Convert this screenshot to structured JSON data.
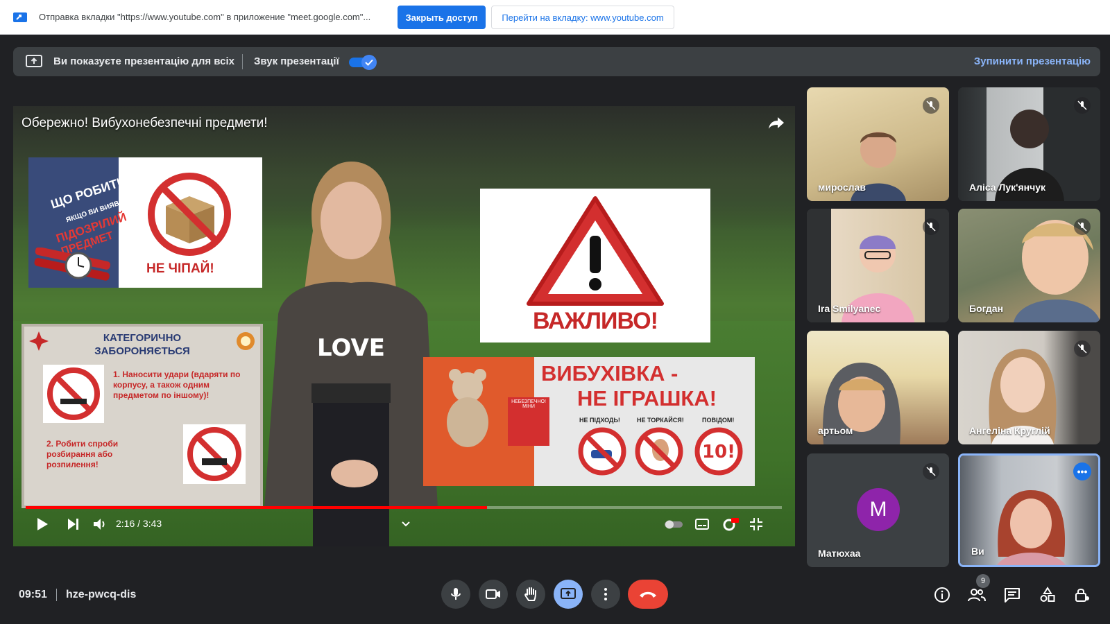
{
  "share_bar": {
    "text": "Отправка вкладки \"https://www.youtube.com\" в приложение \"meet.google.com\"...",
    "close_access": "Закрыть доступ",
    "go_to_tab": "Перейти на вкладку: www.youtube.com"
  },
  "presenting": {
    "status": "Ви показуєте презентацію для всіх",
    "audio_label": "Звук презентації",
    "audio_on": true,
    "stop": "Зупинити презентацію"
  },
  "video": {
    "title": "Обережно! Вибухонебезпечні предмети!",
    "time": "2:16 / 3:43",
    "progress": 0.61,
    "poster1": {
      "line1": "ЩО РОБИТИ,",
      "line2": "ЯКЩО ВИ ВИЯВИЛИ",
      "line3": "ПІДОЗРІЛИЙ",
      "line4": "ПРЕДМЕТ",
      "caption": "НЕ ЧІПАЙ!"
    },
    "poster2": {
      "caption": "ВАЖЛИВО!"
    },
    "poster3": {
      "title1": "КАТЕГОРИЧНО",
      "title2": "ЗАБОРОНЯЄТЬСЯ",
      "rule1": "1. Наносити удари (вдаряти по корпусу, а також одним предметом по іншому)!",
      "rule2": "2. Робити спроби розбирання або розпилення!"
    },
    "poster4": {
      "head1": "ВИБУХІВКА -",
      "head2": "НЕ ІГРАШКА!",
      "label1": "НЕ ПІДХОДЬ!",
      "label2": "НЕ ТОРКАЙСЯ!",
      "label3": "ПОВІДОМ!",
      "danger": "НЕБЕЗПЕЧНО! МІНИ"
    },
    "shirt_text": "LOVE"
  },
  "participants": [
    {
      "name": "мирослав",
      "muted": true
    },
    {
      "name": "Аліса Лук'янчук",
      "muted": true
    },
    {
      "name": "Ira Smilyanec",
      "muted": true
    },
    {
      "name": "Богдан",
      "muted": true
    },
    {
      "name": "артьом",
      "muted": false
    },
    {
      "name": "Ангеліна Круглій",
      "muted": true
    },
    {
      "name": "Матюхаа",
      "muted": true,
      "initial": "M"
    },
    {
      "name": "Ви",
      "muted": false
    }
  ],
  "bottom": {
    "time": "09:51",
    "meeting_code": "hze-pwcq-dis",
    "people_count": "9"
  },
  "colors": {
    "background": "#202124",
    "accent": "#1a73e8",
    "end_call": "#ea4335",
    "avatar": "#8e24aa",
    "progress": "#ff0000"
  }
}
